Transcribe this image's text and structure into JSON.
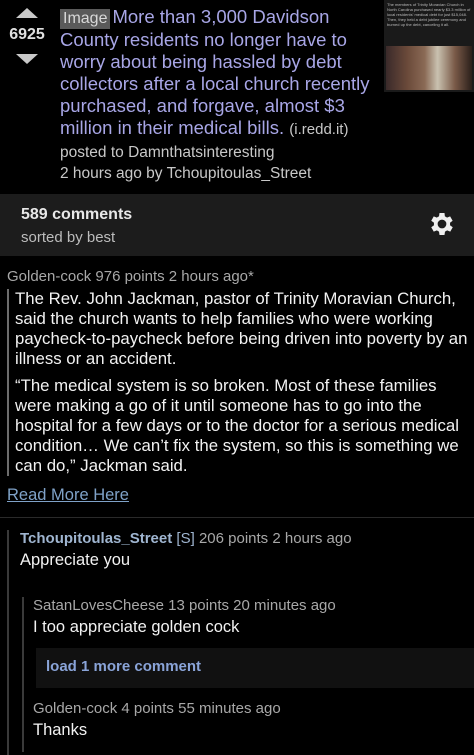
{
  "post": {
    "score": "6925",
    "flair": "Image",
    "title": "More than 3,000 Davidson County residents no longer have to worry about being hassled by debt collectors after a local church recently purchased, and forgave, almost $3 million in their medical bills.",
    "domain": "(i.redd.it)",
    "posted_to": "posted to Damnthatsinteresting",
    "time_by": "2 hours ago by Tchoupitoulas_Street",
    "thumbnail_caption": "The members of Trinity Moravian Church in North Carolina purchased nearly $3.3 million of local residents' medical debt for just $15,048. Then, they held a debt jubilee ceremony and burned up the debt, canceling it all."
  },
  "comments_bar": {
    "count": "589 comments",
    "sort": "sorted by best"
  },
  "comment1": {
    "author": "Golden-cock",
    "points": "976 points",
    "time": "2 hours ago*",
    "para1": "The Rev. John Jackman, pastor of Trinity Moravian Church, said the church wants to help families who were working paycheck-to-paycheck before being driven into poverty by an illness or an accident.",
    "para2": "“The medical system is so broken. Most of these families were making a go of it until someone has to go into the hospital for a few days or to the doctor for a serious medical condition… We can’t fix the system, so this is something we can do,” Jackman said.",
    "read_more": "Read More Here"
  },
  "reply1": {
    "author": "Tchoupitoulas_Street",
    "tag": "[S]",
    "points": "206 points",
    "time": "2 hours ago",
    "body": "Appreciate you"
  },
  "reply2": {
    "author": "SatanLovesCheese",
    "points": "13 points",
    "time": "20 minutes ago",
    "body": "I too appreciate golden cock"
  },
  "load_more": "load 1 more comment",
  "reply3": {
    "author": "Golden-cock",
    "points": "4 points",
    "time": "55 minutes ago",
    "body": "Thanks"
  },
  "icons": {
    "upvote": "upvote-arrow-icon",
    "downvote": "downvote-arrow-icon",
    "settings": "gear-icon"
  },
  "colors": {
    "title": "#a8a6e6",
    "link": "#7fa2c8",
    "op_author": "#9fb5d0",
    "load_more": "#8aa4d8"
  }
}
